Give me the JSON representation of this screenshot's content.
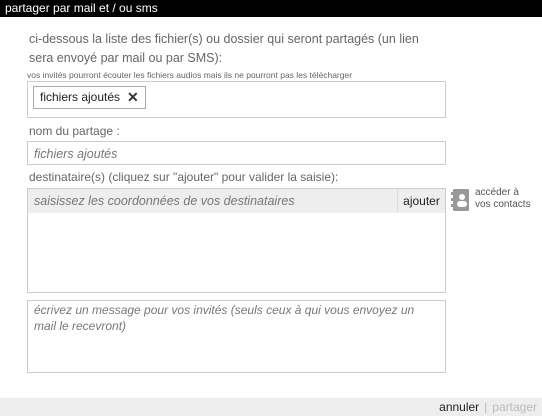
{
  "window": {
    "title": "partager par mail et / ou sms"
  },
  "intro": {
    "line1": "ci-dessous la liste des fichier(s) ou dossier qui seront partagés (un lien",
    "line2": "sera envoyé par mail ou par SMS):",
    "note": "vos invités pourront écouter les fichiers audios mais ils ne pourront pas les télécharger"
  },
  "files": {
    "chip_label": "fichiers ajoutés",
    "remove_icon": "close-icon"
  },
  "share_name": {
    "label": "nom du partage :",
    "value": "fichiers ajoutés"
  },
  "recipients": {
    "label": "destinataire(s) (cliquez sur \"ajouter\" pour valider la saisie):",
    "placeholder": "saisissez les coordonnées de vos destinataires",
    "add_label": "ajouter",
    "contacts_line1": "accéder à",
    "contacts_line2": "vos contacts",
    "contacts_icon": "address-book-icon"
  },
  "message": {
    "placeholder": "écrivez un message pour vos invités (seuls ceux à qui vous envoyez un mail le recevront)"
  },
  "footer": {
    "cancel_label": "annuler",
    "separator": "|",
    "share_label": "partager"
  }
}
